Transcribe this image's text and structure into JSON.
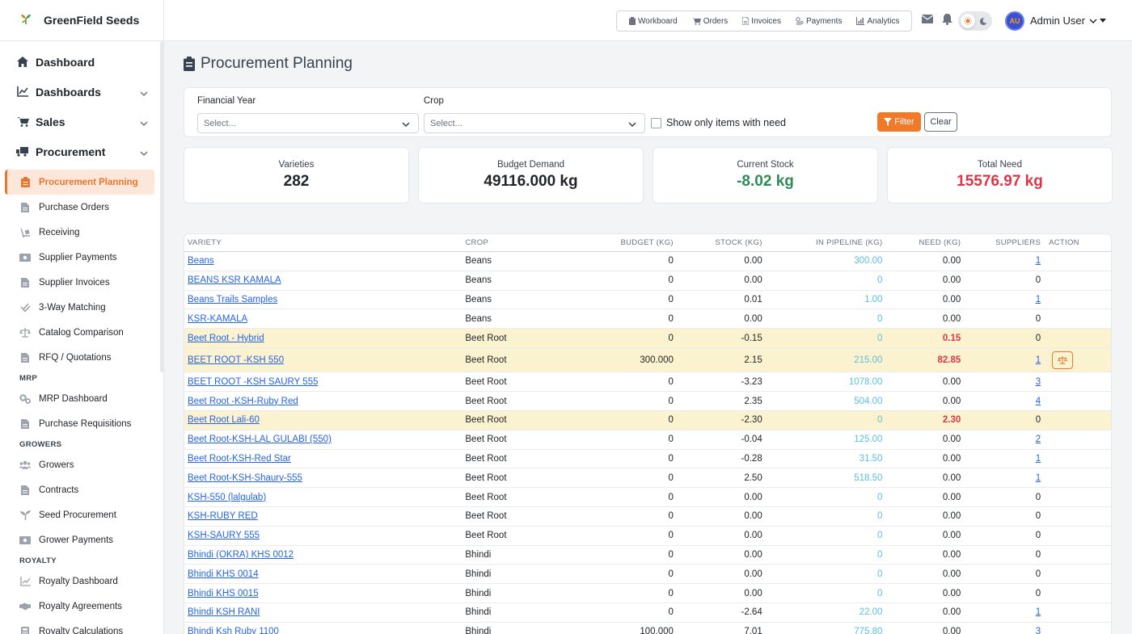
{
  "brand": {
    "name": "GreenField Seeds"
  },
  "sidebar": {
    "top_items": [
      {
        "label": "Dashboard",
        "icon": "home-icon"
      },
      {
        "label": "Dashboards",
        "icon": "chart-line-icon"
      },
      {
        "label": "Sales",
        "icon": "cart-icon"
      },
      {
        "label": "Procurement",
        "icon": "truck-icon"
      }
    ],
    "procurement_items": [
      {
        "label": "Procurement Planning",
        "icon": "clipboard-icon",
        "active": true
      },
      {
        "label": "Purchase Orders",
        "icon": "file-icon"
      },
      {
        "label": "Receiving",
        "icon": "dolly-icon"
      },
      {
        "label": "Supplier Payments",
        "icon": "money-icon"
      },
      {
        "label": "Supplier Invoices",
        "icon": "file-icon"
      },
      {
        "label": "3-Way Matching",
        "icon": "check-double-icon"
      },
      {
        "label": "Catalog Comparison",
        "icon": "balance-scale-icon"
      },
      {
        "label": "RFQ / Quotations",
        "icon": "file-icon"
      }
    ],
    "mrp_label": "MRP",
    "mrp_items": [
      {
        "label": "MRP Dashboard",
        "icon": "cogs-icon"
      },
      {
        "label": "Purchase Requisitions",
        "icon": "file-icon"
      }
    ],
    "growers_label": "GROWERS",
    "growers_items": [
      {
        "label": "Growers",
        "icon": "users-icon"
      },
      {
        "label": "Contracts",
        "icon": "file-icon"
      },
      {
        "label": "Seed Procurement",
        "icon": "seedling-icon"
      },
      {
        "label": "Grower Payments",
        "icon": "money-icon"
      }
    ],
    "royalty_label": "ROYALTY",
    "royalty_items": [
      {
        "label": "Royalty Dashboard",
        "icon": "chart-line-icon"
      },
      {
        "label": "Royalty Agreements",
        "icon": "handshake-icon"
      },
      {
        "label": "Royalty Calculations",
        "icon": "calculator-icon"
      }
    ]
  },
  "topnav": {
    "items": [
      "Workboard",
      "Orders",
      "Invoices",
      "Payments",
      "Analytics"
    ]
  },
  "user": {
    "initials": "AU",
    "name": "Admin User"
  },
  "page": {
    "title": "Procurement Planning"
  },
  "filters": {
    "financial_year_label": "Financial Year",
    "financial_year_placeholder": "Select...",
    "crop_label": "Crop",
    "crop_placeholder": "Select...",
    "need_only_label": "Show only items with need",
    "filter_button": "Filter",
    "clear_button": "Clear"
  },
  "stats": [
    {
      "label": "Varieties",
      "value": "282",
      "color": "#212529"
    },
    {
      "label": "Budget Demand",
      "value": "49116.000 kg",
      "color": "#212529"
    },
    {
      "label": "Current Stock",
      "value": "-8.02 kg",
      "color": "#2e8b57"
    },
    {
      "label": "Total Need",
      "value": "15576.97 kg",
      "color": "#dc3545"
    }
  ],
  "table": {
    "headers": [
      "VARIETY",
      "CROP",
      "BUDGET (KG)",
      "STOCK (KG)",
      "IN PIPELINE (KG)",
      "NEED (KG)",
      "SUPPLIERS",
      "ACTION"
    ],
    "rows": [
      {
        "variety": "Beans",
        "crop": "Beans",
        "budget": "0",
        "stock": "0.00",
        "pipeline": "300.00",
        "need": "0.00",
        "suppliers": "1",
        "sup_link": true
      },
      {
        "variety": "BEANS KSR KAMALA",
        "crop": "Beans",
        "budget": "0",
        "stock": "0.00",
        "pipeline": "0",
        "need": "0.00",
        "suppliers": "0"
      },
      {
        "variety": "Beans Trails Samples",
        "crop": "Beans",
        "budget": "0",
        "stock": "0.01",
        "pipeline": "1.00",
        "need": "0.00",
        "suppliers": "1",
        "sup_link": true
      },
      {
        "variety": "KSR-KAMALA",
        "crop": "Beans",
        "budget": "0",
        "stock": "0.00",
        "pipeline": "0",
        "need": "0.00",
        "suppliers": "0"
      },
      {
        "variety": "Beet Root - Hybrid",
        "crop": "Beet Root",
        "budget": "0",
        "stock": "-0.15",
        "pipeline": "0",
        "need": "0.15",
        "suppliers": "0",
        "highlight": true
      },
      {
        "variety": "BEET ROOT -KSH 550",
        "crop": "Beet Root",
        "budget": "300.000",
        "stock": "2.15",
        "pipeline": "215.00",
        "need": "82.85",
        "suppliers": "1",
        "sup_link": true,
        "highlight": true,
        "action": true
      },
      {
        "variety": "BEET ROOT -KSH SAURY 555",
        "crop": "Beet Root",
        "budget": "0",
        "stock": "-3.23",
        "pipeline": "1078.00",
        "need": "0.00",
        "suppliers": "3",
        "sup_link": true
      },
      {
        "variety": "Beet Root -KSH-Ruby Red",
        "crop": "Beet Root",
        "budget": "0",
        "stock": "2.35",
        "pipeline": "504.00",
        "need": "0.00",
        "suppliers": "4",
        "sup_link": true
      },
      {
        "variety": "Beet Root Lali-60",
        "crop": "Beet Root",
        "budget": "0",
        "stock": "-2.30",
        "pipeline": "0",
        "need": "2.30",
        "suppliers": "0",
        "highlight": true
      },
      {
        "variety": "Beet Root-KSH-LAL GULABI (550)",
        "crop": "Beet Root",
        "budget": "0",
        "stock": "-0.04",
        "pipeline": "125.00",
        "need": "0.00",
        "suppliers": "2",
        "sup_link": true
      },
      {
        "variety": "Beet Root-KSH-Red Star",
        "crop": "Beet Root",
        "budget": "0",
        "stock": "-0.28",
        "pipeline": "31.50",
        "need": "0.00",
        "suppliers": "1",
        "sup_link": true
      },
      {
        "variety": "Beet Root-KSH-Shaury-555",
        "crop": "Beet Root",
        "budget": "0",
        "stock": "2.50",
        "pipeline": "518.50",
        "need": "0.00",
        "suppliers": "1",
        "sup_link": true
      },
      {
        "variety": "KSH-550 (lalgulab)",
        "crop": "Beet Root",
        "budget": "0",
        "stock": "0.00",
        "pipeline": "0",
        "need": "0.00",
        "suppliers": "0"
      },
      {
        "variety": "KSH-RUBY RED",
        "crop": "Beet Root",
        "budget": "0",
        "stock": "0.00",
        "pipeline": "0",
        "need": "0.00",
        "suppliers": "0"
      },
      {
        "variety": "KSH-SAURY 555",
        "crop": "Beet Root",
        "budget": "0",
        "stock": "0.00",
        "pipeline": "0",
        "need": "0.00",
        "suppliers": "0"
      },
      {
        "variety": "Bhindi (OKRA) KHS 0012",
        "crop": "Bhindi",
        "budget": "0",
        "stock": "0.00",
        "pipeline": "0",
        "need": "0.00",
        "suppliers": "0"
      },
      {
        "variety": "Bhindi KHS 0014",
        "crop": "Bhindi",
        "budget": "0",
        "stock": "0.00",
        "pipeline": "0",
        "need": "0.00",
        "suppliers": "0"
      },
      {
        "variety": "Bhindi KHS 0015",
        "crop": "Bhindi",
        "budget": "0",
        "stock": "0.00",
        "pipeline": "0",
        "need": "0.00",
        "suppliers": "0"
      },
      {
        "variety": "Bhindi KSH RANI",
        "crop": "Bhindi",
        "budget": "0",
        "stock": "-2.64",
        "pipeline": "22.00",
        "need": "0.00",
        "suppliers": "1",
        "sup_link": true
      },
      {
        "variety": "Bhindi Ksh Ruby 1100",
        "crop": "Bhindi",
        "budget": "100.000",
        "stock": "7.01",
        "pipeline": "775.80",
        "need": "0.00",
        "suppliers": "3",
        "sup_link": true
      }
    ]
  },
  "colors": {
    "accent": "#f07a2a",
    "link": "#2563eb",
    "pipeline": "#5bc0de",
    "need": "#dc3545",
    "stock": "#2e8b57",
    "highlight_row": "#fbf2d0"
  }
}
